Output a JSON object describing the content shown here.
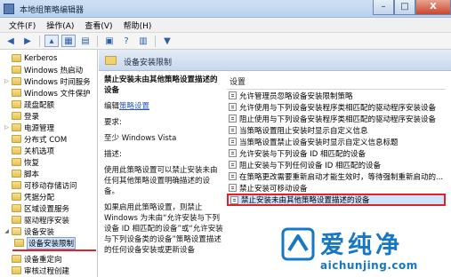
{
  "window": {
    "title": "本地组策略编辑器",
    "buttons": [
      "–",
      "□",
      "X"
    ]
  },
  "menubar": {
    "items": [
      "文件(F)",
      "操作(A)",
      "查看(V)",
      "帮助(H)"
    ]
  },
  "toolbar": {
    "icons": [
      "back-arrow-icon",
      "forward-arrow-icon",
      "up-folder-icon",
      "show-hide-tree-icon",
      "export-icon",
      "properties-icon",
      "help-icon",
      "view-icon",
      "filter-icon"
    ]
  },
  "tree": {
    "items": [
      {
        "label": "Kerberos",
        "expanded": false
      },
      {
        "label": "Windows 热启动",
        "expanded": false
      },
      {
        "label": "Windows 时间服务",
        "expanded": false
      },
      {
        "label": "Windows 文件保护",
        "expanded": false
      },
      {
        "label": "疏盘配额",
        "expanded": false
      },
      {
        "label": "登录",
        "expanded": false
      },
      {
        "label": "电源管理",
        "expanded": false
      },
      {
        "label": "分布式 COM",
        "expanded": false
      },
      {
        "label": "关机选项",
        "expanded": false
      },
      {
        "label": "恢复",
        "expanded": false
      },
      {
        "label": "脚本",
        "expanded": false
      },
      {
        "label": "可移动存储访问",
        "expanded": false
      },
      {
        "label": "凭据分配",
        "expanded": false
      },
      {
        "label": "区域设置服务",
        "expanded": false
      },
      {
        "label": "驱动程序安装",
        "expanded": false
      },
      {
        "label": "设备安装",
        "expanded": true
      },
      {
        "label": "设备安装限制",
        "selected": true
      },
      {
        "label": "设备重定向",
        "expanded": false
      },
      {
        "label": "审核过程创建",
        "expanded": false
      }
    ]
  },
  "content": {
    "header_title": "设备安装限制",
    "description": {
      "policy_title": "禁止安装未由其他策略设置描述的设备",
      "edit_prefix": "编辑",
      "edit_link": "策略设置",
      "requirements_label": "要求:",
      "requirements_value": "至少 Windows Vista",
      "description_label": "描述:",
      "description_text": "使用此策略设置可以禁止安装未由任何其他策略设置明确描述的设备。",
      "extra_text": "如果启用此策略设置，则禁止 Windows 为未由“允许安装与下列设备 ID 相匹配的设备”或“允许安装与下列设备类的设备”策略设置描述的任何设备安装或更新设备"
    },
    "list_header": "设置",
    "rows": [
      "允许管理员忽略设备安装限制策略",
      "允许使用与下列设备安装程序类相匹配的驱动程序安装设备",
      "阻止使用与下列设备安装程序类相匹配的驱动程序安装设备",
      "当策略设置阻止安装时显示自定义信息",
      "当策略设置禁止设备安装时显示自定义信息标题",
      "允许安装与下列设备 ID 相匹配的设备",
      "阻止安装与下列任何设备 ID 相匹配的设备",
      "在策略更改需要重新启动才能生效时，等待强制重新启动的...",
      "禁止安装可移动设备",
      "禁止安装未由其他策略设置描述的设备"
    ],
    "selected_row_index": 9
  },
  "watermark": {
    "text": "爱纯净",
    "domain": "aichunjing.com"
  },
  "colors": {
    "accent": "#1677c4",
    "highlight": "#e02228",
    "selection": "#cfe3fb"
  }
}
